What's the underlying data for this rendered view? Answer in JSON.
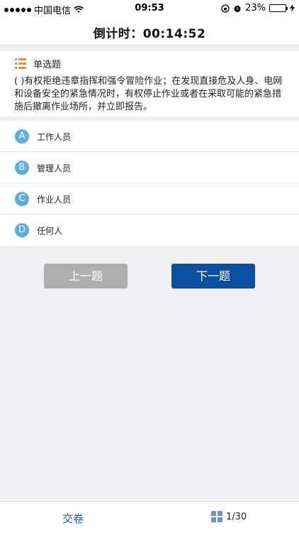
{
  "status_bar": {
    "carrier": "中国电信",
    "time": "09:53",
    "battery": "23%",
    "battery_level": 0.23
  },
  "nav": {
    "title": "倒计时：00:14:52"
  },
  "question": {
    "type_label": "单选题",
    "text": "( )有权拒绝违章指挥和强令冒险作业；在发现直接危及人身、电网和设备安全的紧急情况时，有权停止作业或者在采取可能的紧急措施后撤离作业场所，并立即报告。",
    "options": [
      {
        "letter": "A",
        "text": "工作人员"
      },
      {
        "letter": "B",
        "text": "管理人员"
      },
      {
        "letter": "C",
        "text": "作业人员"
      },
      {
        "letter": "D",
        "text": "任何人"
      }
    ]
  },
  "buttons": {
    "prev": "上一题",
    "next": "下一题"
  },
  "bottom": {
    "submit": "交卷",
    "progress": "1/30"
  },
  "colors": {
    "accent": "#0b4f9e",
    "option_circle": "#5aaee3",
    "disabled_button": "#aeaeae",
    "list_icon": "#e08e4f",
    "grid_icon": "#6d8fd6"
  }
}
